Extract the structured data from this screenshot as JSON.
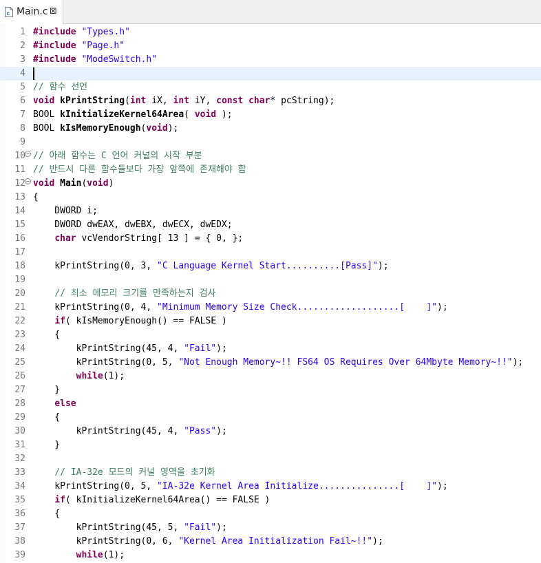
{
  "tab": {
    "label": "Main.c",
    "close_glyph": "⊠",
    "icon": "c-file-icon"
  },
  "colors": {
    "keyword": "#7f0055",
    "string": "#2a00ff",
    "comment": "#3f7f5f",
    "line_number": "#787878",
    "current_line": "#e8f2fe"
  },
  "editor": {
    "current_line": 4,
    "lines": [
      {
        "n": "1",
        "t": [
          [
            "kw",
            "#include"
          ],
          [
            "p",
            " "
          ],
          [
            "str",
            "\"Types.h\""
          ]
        ]
      },
      {
        "n": "2",
        "t": [
          [
            "kw",
            "#include"
          ],
          [
            "p",
            " "
          ],
          [
            "str",
            "\"Page.h\""
          ]
        ]
      },
      {
        "n": "3",
        "t": [
          [
            "kw",
            "#include"
          ],
          [
            "p",
            " "
          ],
          [
            "str",
            "\"ModeSwitch.h\""
          ]
        ]
      },
      {
        "n": "4",
        "t": []
      },
      {
        "n": "5",
        "t": [
          [
            "com",
            "// 함수 선언"
          ]
        ]
      },
      {
        "n": "6",
        "t": [
          [
            "kw",
            "void"
          ],
          [
            "p",
            " "
          ],
          [
            "fn",
            "kPrintString"
          ],
          [
            "p",
            "("
          ],
          [
            "kw",
            "int"
          ],
          [
            "p",
            " iX, "
          ],
          [
            "kw",
            "int"
          ],
          [
            "p",
            " iY, "
          ],
          [
            "kw",
            "const"
          ],
          [
            "p",
            " "
          ],
          [
            "kw",
            "char"
          ],
          [
            "p",
            "* pcString);"
          ]
        ]
      },
      {
        "n": "7",
        "t": [
          [
            "p",
            "BOOL "
          ],
          [
            "fn",
            "kInitializeKernel64Area"
          ],
          [
            "p",
            "( "
          ],
          [
            "kw",
            "void"
          ],
          [
            "p",
            " );"
          ]
        ]
      },
      {
        "n": "8",
        "t": [
          [
            "p",
            "BOOL "
          ],
          [
            "fn",
            "kIsMemoryEnough"
          ],
          [
            "p",
            "("
          ],
          [
            "kw",
            "void"
          ],
          [
            "p",
            ");"
          ]
        ]
      },
      {
        "n": "9",
        "t": []
      },
      {
        "n": "10",
        "fold": true,
        "t": [
          [
            "com",
            "// 아래 함수는 C 언어 커널의 시작 부분"
          ]
        ]
      },
      {
        "n": "11",
        "t": [
          [
            "com",
            "// 반드시 다른 함수들보다 가장 앞쪽에 존재해야 함"
          ]
        ]
      },
      {
        "n": "12",
        "fold": true,
        "t": [
          [
            "kw",
            "void"
          ],
          [
            "p",
            " "
          ],
          [
            "fn",
            "Main"
          ],
          [
            "p",
            "("
          ],
          [
            "kw",
            "void"
          ],
          [
            "p",
            ")"
          ]
        ]
      },
      {
        "n": "13",
        "t": [
          [
            "p",
            "{"
          ]
        ]
      },
      {
        "n": "14",
        "t": [
          [
            "p",
            "    DWORD i;"
          ]
        ]
      },
      {
        "n": "15",
        "t": [
          [
            "p",
            "    DWORD dwEAX, dwEBX, dwECX, dwEDX;"
          ]
        ]
      },
      {
        "n": "16",
        "t": [
          [
            "p",
            "    "
          ],
          [
            "kw",
            "char"
          ],
          [
            "p",
            " vcVendorString[ 13 ] = { 0, };"
          ]
        ]
      },
      {
        "n": "17",
        "t": []
      },
      {
        "n": "18",
        "t": [
          [
            "p",
            "    kPrintString(0, 3, "
          ],
          [
            "str",
            "\"C Language Kernel Start..........[Pass]\""
          ],
          [
            "p",
            ");"
          ]
        ]
      },
      {
        "n": "19",
        "t": []
      },
      {
        "n": "20",
        "t": [
          [
            "p",
            "    "
          ],
          [
            "com",
            "// 최소 메모리 크기를 만족하는지 검사"
          ]
        ]
      },
      {
        "n": "21",
        "t": [
          [
            "p",
            "    kPrintString(0, 4, "
          ],
          [
            "str",
            "\"Minimum Memory Size Check...................[    ]\""
          ],
          [
            "p",
            ");"
          ]
        ]
      },
      {
        "n": "22",
        "t": [
          [
            "p",
            "    "
          ],
          [
            "kw",
            "if"
          ],
          [
            "p",
            "( kIsMemoryEnough() == FALSE )"
          ]
        ]
      },
      {
        "n": "23",
        "t": [
          [
            "p",
            "    {"
          ]
        ]
      },
      {
        "n": "24",
        "t": [
          [
            "p",
            "        kPrintString(45, 4, "
          ],
          [
            "str",
            "\"Fail\""
          ],
          [
            "p",
            ");"
          ]
        ]
      },
      {
        "n": "25",
        "t": [
          [
            "p",
            "        kPrintString(0, 5, "
          ],
          [
            "str",
            "\"Not Enough Memory~!! FS64 OS Requires Over 64Mbyte Memory~!!\""
          ],
          [
            "p",
            ");"
          ]
        ]
      },
      {
        "n": "26",
        "t": [
          [
            "p",
            "        "
          ],
          [
            "kw",
            "while"
          ],
          [
            "p",
            "(1);"
          ]
        ]
      },
      {
        "n": "27",
        "t": [
          [
            "p",
            "    }"
          ]
        ]
      },
      {
        "n": "28",
        "t": [
          [
            "p",
            "    "
          ],
          [
            "kw",
            "else"
          ]
        ]
      },
      {
        "n": "29",
        "t": [
          [
            "p",
            "    {"
          ]
        ]
      },
      {
        "n": "30",
        "t": [
          [
            "p",
            "        kPrintString(45, 4, "
          ],
          [
            "str",
            "\"Pass\""
          ],
          [
            "p",
            ");"
          ]
        ]
      },
      {
        "n": "31",
        "t": [
          [
            "p",
            "    }"
          ]
        ]
      },
      {
        "n": "32",
        "t": []
      },
      {
        "n": "33",
        "t": [
          [
            "p",
            "    "
          ],
          [
            "com",
            "// IA-32e 모드의 커널 영역을 초기화"
          ]
        ]
      },
      {
        "n": "34",
        "t": [
          [
            "p",
            "    kPrintString(0, 5, "
          ],
          [
            "str",
            "\"IA-32e Kernel Area Initialize...............[    ]\""
          ],
          [
            "p",
            ");"
          ]
        ]
      },
      {
        "n": "35",
        "t": [
          [
            "p",
            "    "
          ],
          [
            "kw",
            "if"
          ],
          [
            "p",
            "( kInitializeKernel64Area() == FALSE )"
          ]
        ]
      },
      {
        "n": "36",
        "t": [
          [
            "p",
            "    {"
          ]
        ]
      },
      {
        "n": "37",
        "t": [
          [
            "p",
            "        kPrintString(45, 5, "
          ],
          [
            "str",
            "\"Fail\""
          ],
          [
            "p",
            ");"
          ]
        ]
      },
      {
        "n": "38",
        "t": [
          [
            "p",
            "        kPrintString(0, 6, "
          ],
          [
            "str",
            "\"Kernel Area Initialization Fail~!!\""
          ],
          [
            "p",
            ");"
          ]
        ]
      },
      {
        "n": "39",
        "t": [
          [
            "p",
            "        "
          ],
          [
            "kw",
            "while"
          ],
          [
            "p",
            "(1);"
          ]
        ]
      }
    ]
  }
}
